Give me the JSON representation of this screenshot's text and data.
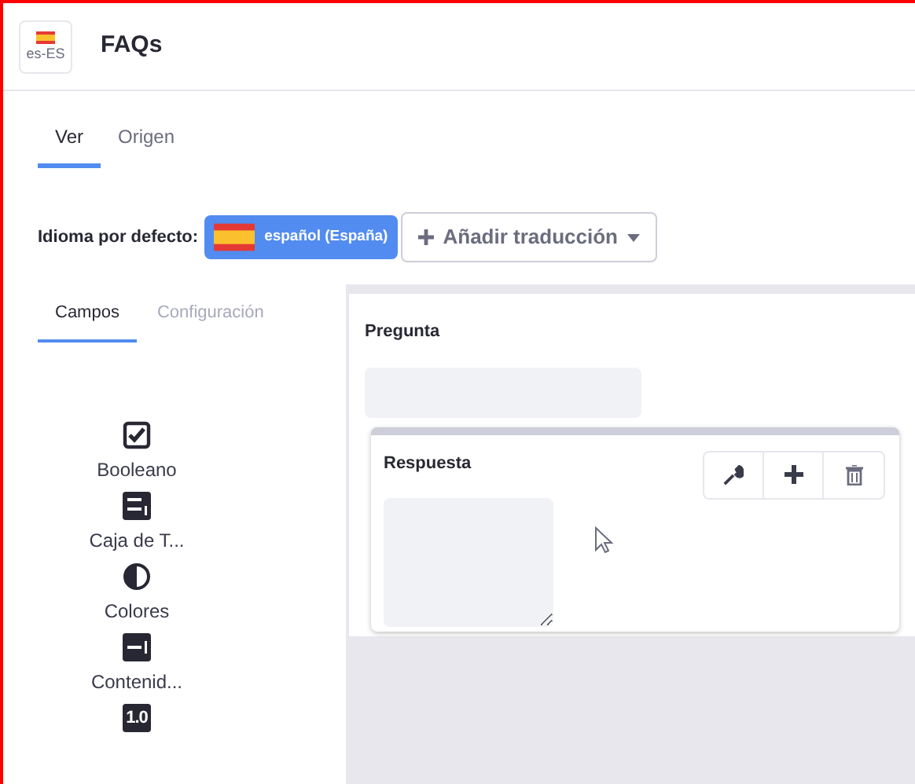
{
  "header": {
    "locale": "es-ES",
    "title": "FAQs"
  },
  "tabs": [
    {
      "label": "Ver",
      "selected": true
    },
    {
      "label": "Origen",
      "selected": false
    }
  ],
  "language": {
    "label": "Idioma por defecto:",
    "default": "español (España)",
    "add_button": "Añadir traducción"
  },
  "panel_tabs": [
    {
      "label": "Campos",
      "selected": true
    },
    {
      "label": "Configuración",
      "selected": false
    }
  ],
  "fields": [
    {
      "kind": "checkbox",
      "label": "Booleano"
    },
    {
      "kind": "textbox",
      "label": "Caja de T..."
    },
    {
      "kind": "contrast",
      "label": "Colores"
    },
    {
      "kind": "text",
      "label": "Contenid..."
    },
    {
      "kind": "number",
      "badge": "1.0"
    }
  ],
  "form": {
    "question": {
      "label": "Pregunta"
    },
    "answer": {
      "label": "Respuesta"
    }
  }
}
